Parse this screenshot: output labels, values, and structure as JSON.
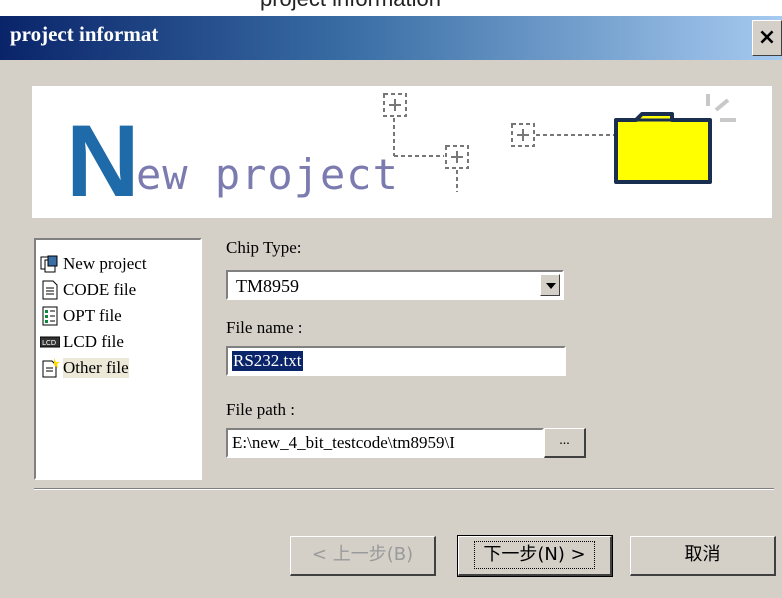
{
  "top_caption": {
    "text_left": "project information"
  },
  "window": {
    "title": "project informat",
    "close_label": "×"
  },
  "banner": {
    "big_letter": "N",
    "text": "ew project",
    "accent_color": "#1f6aa8",
    "folder_color": "#ffff00"
  },
  "file_types": [
    {
      "label": "New project",
      "icon": "project-icon"
    },
    {
      "label": "CODE file",
      "icon": "document-icon"
    },
    {
      "label": "OPT file",
      "icon": "option-file-icon"
    },
    {
      "label": "LCD file",
      "icon": "lcd-icon"
    },
    {
      "label": "Other file",
      "icon": "other-file-icon",
      "selected": true
    }
  ],
  "form": {
    "chip_type_label": "Chip Type:",
    "chip_type_value": "TM8959",
    "file_name_label": "File name :",
    "file_name_value": "RS232.txt",
    "file_path_label": "File path :",
    "file_path_value": "E:\\new_4_bit_testcode\\tm8959\\I",
    "browse_label": "..."
  },
  "buttons": {
    "back": "< 上一步(B)",
    "next": "下一步(N) >",
    "cancel": "取消"
  }
}
